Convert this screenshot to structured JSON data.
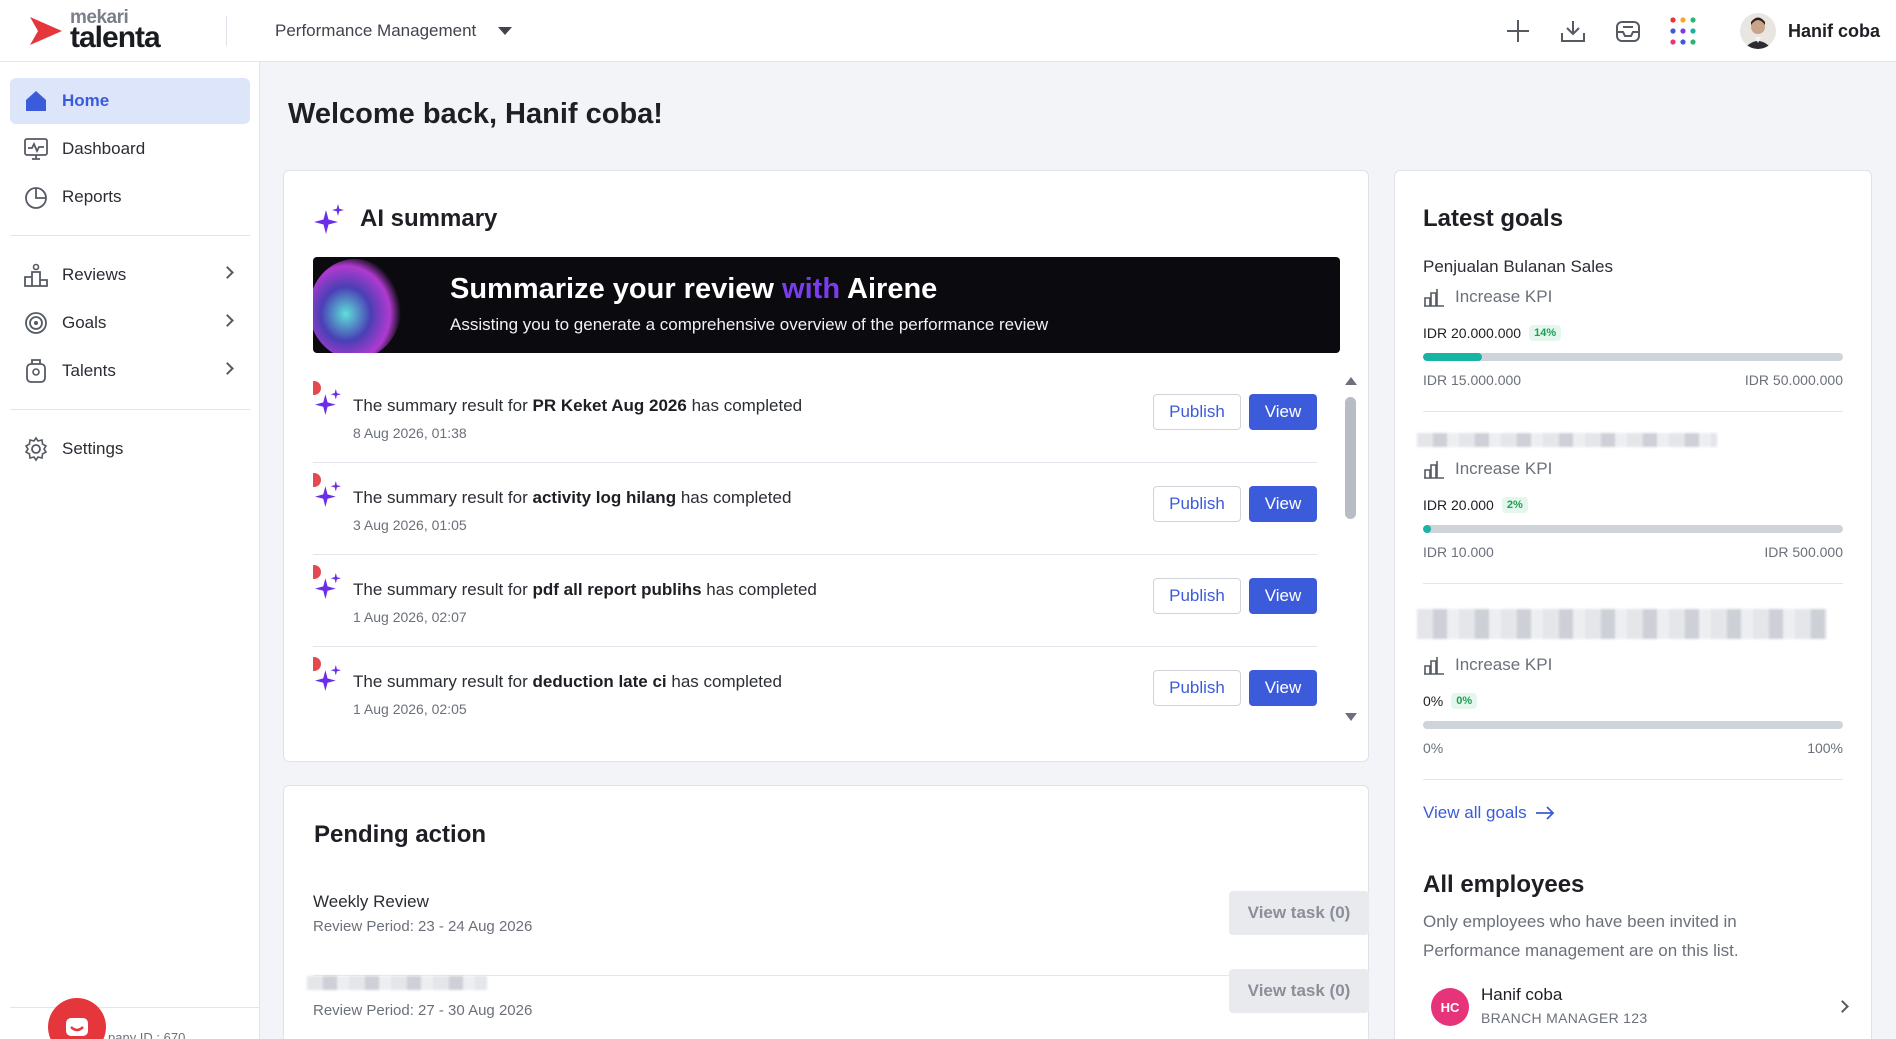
{
  "app": {
    "brand_small": "mekari",
    "brand_big": "talenta",
    "module": "Performance Management",
    "user_name": "Hanif coba",
    "colors": {
      "primary": "#3b5bdb",
      "brand_red": "#e5363c",
      "accent_purple": "#7b3cf0"
    }
  },
  "topbar": {
    "icons": [
      "plus-icon",
      "download-icon",
      "inbox-icon",
      "apps-grid-icon"
    ]
  },
  "sidebar": {
    "items": [
      {
        "label": "Home",
        "icon": "home-icon"
      },
      {
        "label": "Dashboard",
        "icon": "dashboard-icon"
      },
      {
        "label": "Reports",
        "icon": "pie-chart-icon"
      },
      {
        "label": "Reviews",
        "icon": "podium-icon"
      },
      {
        "label": "Goals",
        "icon": "target-icon"
      },
      {
        "label": "Talents",
        "icon": "badge-icon"
      },
      {
        "label": "Settings",
        "icon": "gear-icon"
      }
    ],
    "footer_text": "pany ID : 670"
  },
  "main": {
    "welcome": "Welcome back, Hanif coba!",
    "ai_summary": {
      "title": "AI summary",
      "banner_title_a": "Summarize your review",
      "banner_title_hl": "with",
      "banner_title_b": "Airene",
      "banner_subtitle": "Assisting you to generate a comprehensive overview of the performance review",
      "publish_label": "Publish",
      "view_label": "View",
      "items": [
        {
          "prefix": "The summary result for",
          "name": "PR Keket Aug 2026",
          "suffix": "has completed",
          "date": "8 Aug 2026, 01:38"
        },
        {
          "prefix": "The summary result for",
          "name": "activity log hilang",
          "suffix": "has completed",
          "date": "3 Aug 2026, 01:05"
        },
        {
          "prefix": "The summary result for",
          "name": "pdf all report publihs",
          "suffix": "has completed",
          "date": "1 Aug 2026, 02:07"
        },
        {
          "prefix": "The summary result for",
          "name": "deduction late ci",
          "suffix": "has completed",
          "date": "1 Aug 2026, 02:05"
        }
      ]
    },
    "pending": {
      "title": "Pending action",
      "items": [
        {
          "name": "Weekly Review",
          "period": "Review Period: 23 - 24 Aug 2026",
          "button": "View task (0)"
        },
        {
          "name": "",
          "period": "Review Period: 27 - 30 Aug 2026",
          "button": "View task (0)"
        }
      ]
    }
  },
  "right": {
    "goals_title": "Latest goals",
    "goals": [
      {
        "name": "Penjualan Bulanan Sales",
        "kpi": "Increase KPI",
        "value": "IDR 20.000.000",
        "pct": "14%",
        "progress": 0.14,
        "min": "IDR 15.000.000",
        "max": "IDR 50.000.000"
      },
      {
        "name": "",
        "kpi": "Increase KPI",
        "value": "IDR 20.000",
        "pct": "2%",
        "progress": 0.02,
        "min": "IDR 10.000",
        "max": "IDR 500.000"
      },
      {
        "name": "",
        "kpi": "Increase KPI",
        "value": "0%",
        "pct": "0%",
        "progress": 0.0,
        "min": "0%",
        "max": "100%"
      }
    ],
    "view_all": "View all goals",
    "employees_title": "All employees",
    "employees_desc": "Only employees who have been invited in Performance management are on this list.",
    "employees": [
      {
        "initials": "HC",
        "name": "Hanif coba",
        "role": "BRANCH MANAGER 123"
      }
    ]
  }
}
